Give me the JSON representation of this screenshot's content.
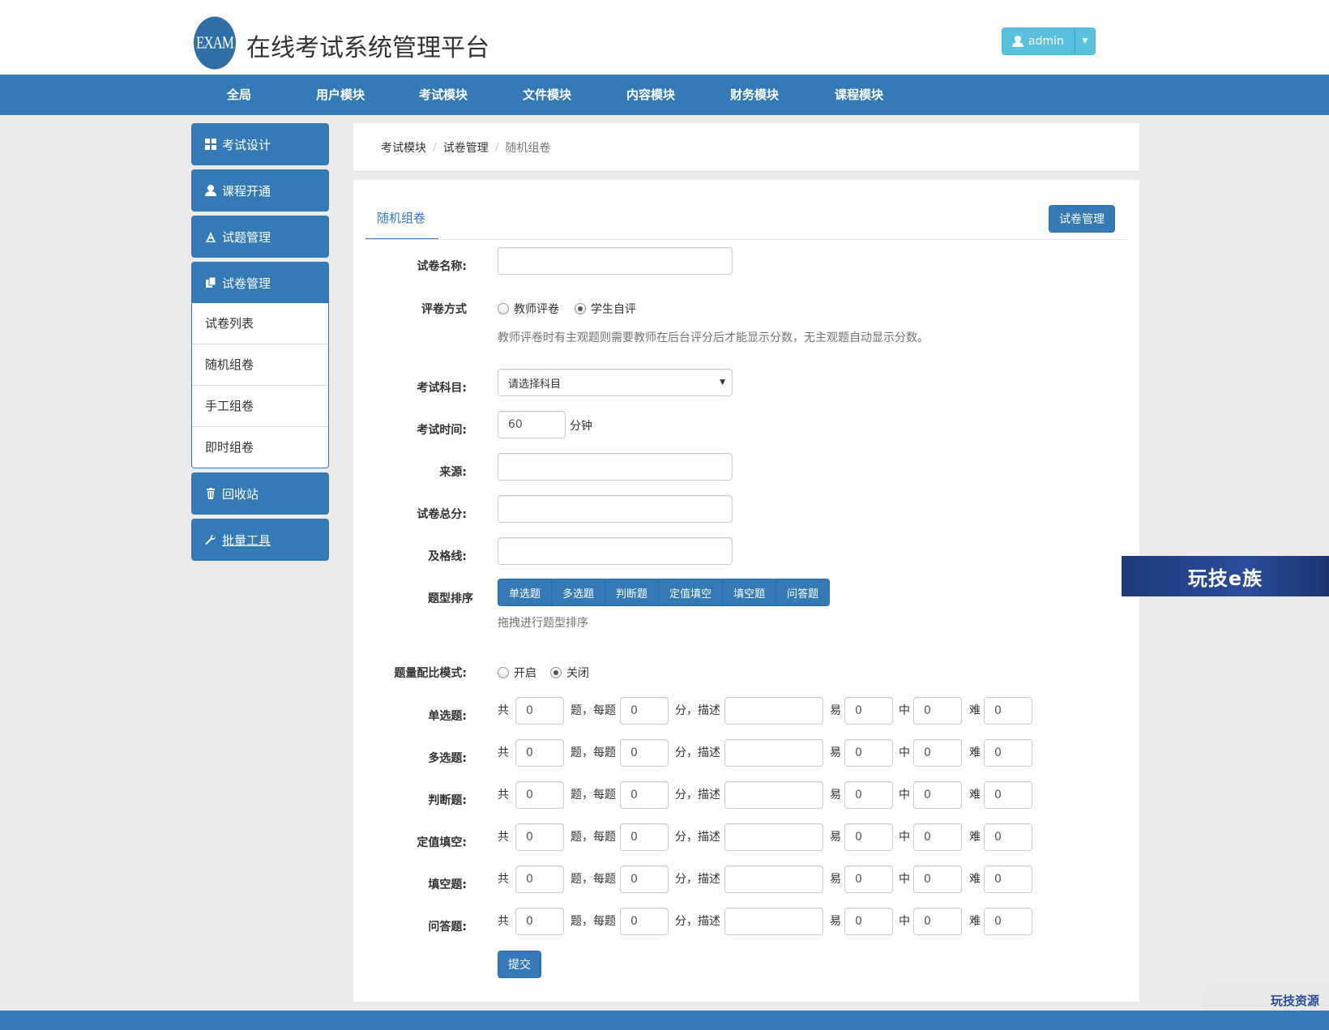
{
  "header": {
    "logo_text": "EXAM",
    "title": "在线考试系统管理平台",
    "user_label": "admin"
  },
  "nav": [
    "全局",
    "用户模块",
    "考试模块",
    "文件模块",
    "内容模块",
    "财务模块",
    "课程模块"
  ],
  "sidebar": {
    "items": [
      {
        "label": "考试设计",
        "icon": "grid-icon"
      },
      {
        "label": "课程开通",
        "icon": "user-icon"
      },
      {
        "label": "试题管理",
        "icon": "text-icon"
      },
      {
        "label": "试卷管理",
        "icon": "copy-icon"
      },
      {
        "label": "回收站",
        "icon": "trash-icon"
      },
      {
        "label": "批量工具",
        "icon": "wrench-icon"
      }
    ],
    "sub_items": [
      "试卷列表",
      "随机组卷",
      "手工组卷",
      "即时组卷"
    ]
  },
  "breadcrumb": [
    "考试模块",
    "试卷管理",
    "随机组卷"
  ],
  "main": {
    "tab": "随机组卷",
    "manage_button": "试卷管理",
    "fields": {
      "paper_name": "试卷名称:",
      "grading": "评卷方式",
      "grading_options": [
        "教师评卷",
        "学生自评"
      ],
      "grading_selected": "学生自评",
      "grading_help": "教师评卷时有主观题则需要教师在后台评分后才能显示分数，无主观题自动显示分数。",
      "subject": "考试科目:",
      "subject_value": "请选择科目",
      "duration": "考试时间:",
      "duration_value": "60",
      "duration_unit": "分钟",
      "source": "来源:",
      "total_score": "试卷总分:",
      "pass_line": "及格线:",
      "sort_label": "题型排序",
      "sort_types": [
        "单选题",
        "多选题",
        "判断题",
        "定值填空",
        "填空题",
        "问答题"
      ],
      "sort_help": "拖拽进行题型排序",
      "ratio_mode": "题量配比模式:",
      "ratio_options": [
        "开启",
        "关闭"
      ],
      "ratio_selected": "关闭"
    },
    "row_words": {
      "total": "共",
      "per": "题，每题",
      "desc": "分，描述",
      "easy": "易",
      "mid": "中",
      "hard": "难"
    },
    "question_rows": [
      {
        "label": "单选题:",
        "count": "0",
        "score": "0",
        "desc": "",
        "easy": "0",
        "mid": "0",
        "hard": "0"
      },
      {
        "label": "多选题:",
        "count": "0",
        "score": "0",
        "desc": "",
        "easy": "0",
        "mid": "0",
        "hard": "0"
      },
      {
        "label": "判断题:",
        "count": "0",
        "score": "0",
        "desc": "",
        "easy": "0",
        "mid": "0",
        "hard": "0"
      },
      {
        "label": "定值填空:",
        "count": "0",
        "score": "0",
        "desc": "",
        "easy": "0",
        "mid": "0",
        "hard": "0"
      },
      {
        "label": "填空题:",
        "count": "0",
        "score": "0",
        "desc": "",
        "easy": "0",
        "mid": "0",
        "hard": "0"
      },
      {
        "label": "问答题:",
        "count": "0",
        "score": "0",
        "desc": "",
        "easy": "0",
        "mid": "0",
        "hard": "0"
      }
    ],
    "submit": "提交"
  },
  "watermarks": {
    "badge": "玩技e族",
    "corner": "玩技资源"
  },
  "colors": {
    "primary": "#337ab7",
    "info": "#5bc0de",
    "background": "#ebebeb"
  }
}
